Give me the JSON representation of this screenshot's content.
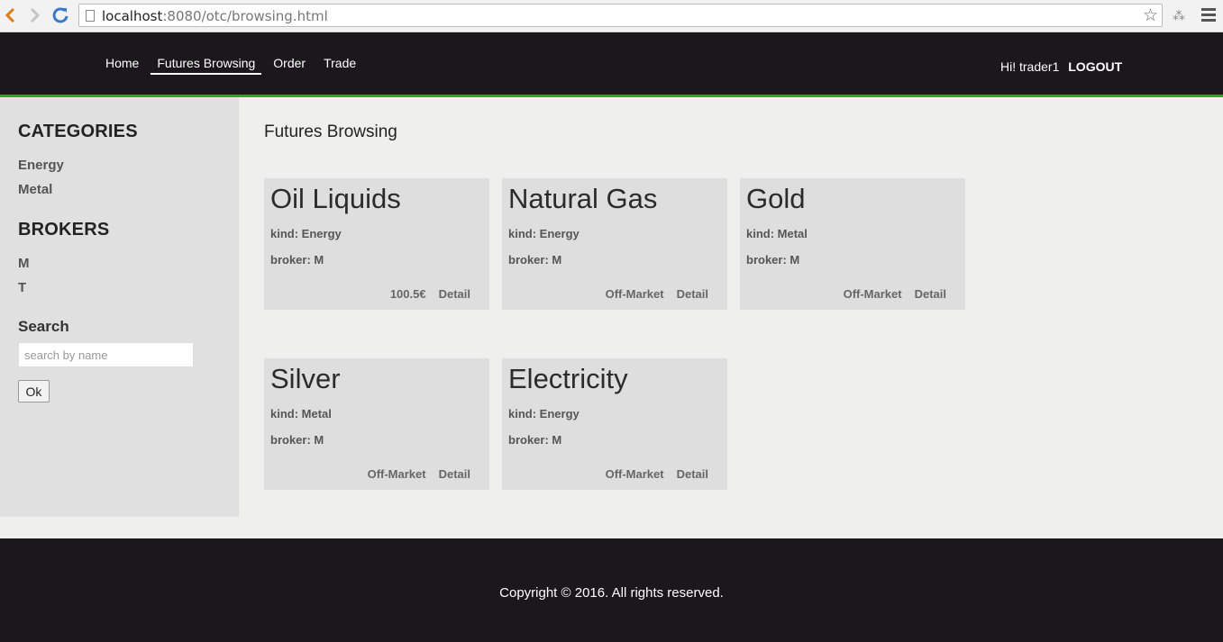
{
  "browser": {
    "url_host": "localhost",
    "url_rest": ":8080/otc/browsing.html"
  },
  "header": {
    "nav": [
      "Home",
      "Futures Browsing",
      "Order",
      "Trade"
    ],
    "greeting": "Hi! trader1",
    "logout": "LOGOUT"
  },
  "sidebar": {
    "categories_heading": "CATEGORIES",
    "categories": [
      "Energy",
      "Metal"
    ],
    "brokers_heading": "BROKERS",
    "brokers": [
      "M",
      "T"
    ],
    "search_label": "Search",
    "search_placeholder": "search by name",
    "ok_label": "Ok"
  },
  "main": {
    "title": "Futures Browsing",
    "cards": [
      {
        "name": "Oil Liquids",
        "kind": "kind: Energy",
        "broker": "broker: M",
        "status": "100.5€",
        "detail": "Detail"
      },
      {
        "name": "Natural Gas",
        "kind": "kind: Energy",
        "broker": "broker: M",
        "status": "Off-Market",
        "detail": "Detail"
      },
      {
        "name": "Gold",
        "kind": "kind: Metal",
        "broker": "broker: M",
        "status": "Off-Market",
        "detail": "Detail"
      },
      {
        "name": "Silver",
        "kind": "kind: Metal",
        "broker": "broker: M",
        "status": "Off-Market",
        "detail": "Detail"
      },
      {
        "name": "Electricity",
        "kind": "kind: Energy",
        "broker": "broker: M",
        "status": "Off-Market",
        "detail": "Detail"
      }
    ]
  },
  "footer": {
    "copyright": "Copyright © 2016. All rights reserved."
  },
  "colors": {
    "header_bg": "#1a181a",
    "accent_green": "#2aa52a",
    "sidebar_bg": "#e0e0e0",
    "card_bg": "#dedede"
  }
}
